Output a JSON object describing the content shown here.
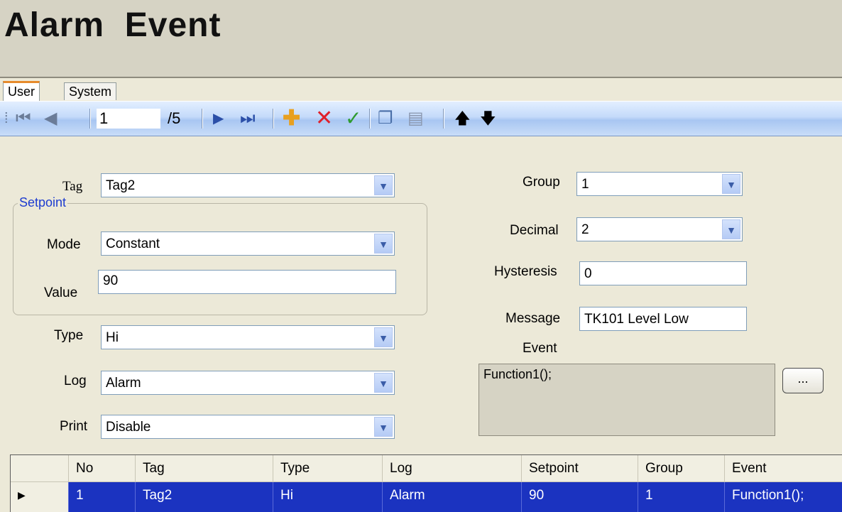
{
  "page": {
    "title": "Alarm  Event"
  },
  "tabs": [
    {
      "label": "User"
    },
    {
      "label": "System"
    }
  ],
  "toolbar": {
    "current_record": "1",
    "total_records": "/5",
    "icons": [
      "first-record-icon",
      "previous-record-icon",
      "next-record-icon",
      "last-record-icon",
      "add-icon",
      "delete-icon",
      "confirm-icon",
      "copy-icon",
      "paste-icon",
      "move-up-icon",
      "move-down-icon"
    ],
    "accent_colors": {
      "add": "#E8A020",
      "delete": "#E0202A",
      "confirm": "#2E9A2E"
    }
  },
  "form": {
    "tag": {
      "label": "Tag",
      "value": "Tag2"
    },
    "setpoint": {
      "legend": "Setpoint",
      "mode": {
        "label": "Mode",
        "value": "Constant"
      },
      "value": {
        "label": "Value",
        "value": "90"
      }
    },
    "type": {
      "label": "Type",
      "value": "Hi"
    },
    "log": {
      "label": "Log",
      "value": "Alarm"
    },
    "print": {
      "label": "Print",
      "value": "Disable"
    },
    "group": {
      "label": "Group",
      "value": "1"
    },
    "decimal": {
      "label": "Decimal",
      "value": "2"
    },
    "hysteresis": {
      "label": "Hysteresis",
      "value": "0"
    },
    "message": {
      "label": "Message",
      "value": "TK101 Level Low"
    },
    "event": {
      "label": "Event",
      "value": "Function1();",
      "browse_label": "..."
    }
  },
  "grid": {
    "columns": [
      "No",
      "Tag",
      "Type",
      "Log",
      "Setpoint",
      "Group",
      "Event"
    ],
    "rows": [
      {
        "no": "1",
        "tag": "Tag2",
        "type": "Hi",
        "log": "Alarm",
        "setpoint": "90",
        "group": "1",
        "event": "Function1();"
      }
    ],
    "selection_color": "#1B33C0"
  }
}
